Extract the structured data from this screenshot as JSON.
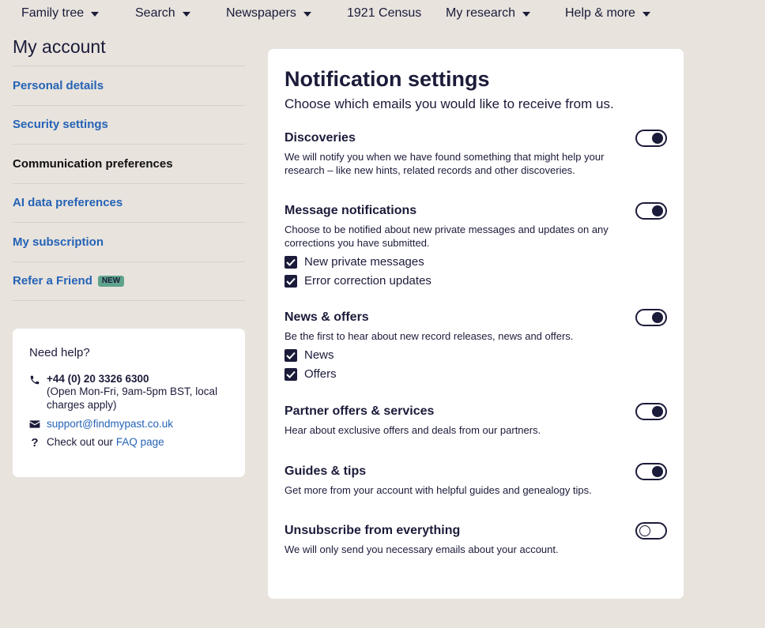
{
  "nav": {
    "items": [
      {
        "label": "Family tree",
        "dropdown": true
      },
      {
        "label": "Search",
        "dropdown": true
      },
      {
        "label": "Newspapers",
        "dropdown": true
      },
      {
        "label": "1921 Census",
        "dropdown": false
      },
      {
        "label": "My research",
        "dropdown": true
      },
      {
        "label": "Help & more",
        "dropdown": true
      }
    ]
  },
  "sidebar": {
    "title": "My account",
    "items": [
      {
        "label": "Personal details",
        "active": false
      },
      {
        "label": "Security settings",
        "active": false
      },
      {
        "label": "Communication preferences",
        "active": true
      },
      {
        "label": "AI data preferences",
        "active": false
      },
      {
        "label": "My subscription",
        "active": false
      },
      {
        "label": "Refer a Friend",
        "active": false,
        "badge": "NEW"
      }
    ]
  },
  "help": {
    "title": "Need help?",
    "phone": "+44 (0) 20 3326 6300",
    "phone_hours": "(Open Mon-Fri, 9am-5pm BST, local charges apply)",
    "email": "support@findmypast.co.uk",
    "faq_prefix": "Check out our",
    "faq_link": "FAQ page"
  },
  "main": {
    "title": "Notification settings",
    "subtitle": "Choose which emails you would like to receive from us.",
    "sections": [
      {
        "title": "Discoveries",
        "description": "We will notify you when we have found something that might help your research – like new hints, related records and other discoveries.",
        "enabled": true,
        "options": []
      },
      {
        "title": "Message notifications",
        "description": "Choose to be notified about new private messages and updates on any corrections you have submitted.",
        "enabled": true,
        "options": [
          {
            "label": "New private messages",
            "checked": true
          },
          {
            "label": "Error correction updates",
            "checked": true
          }
        ]
      },
      {
        "title": "News & offers",
        "description": "Be the first to hear about new record releases, news and offers.",
        "enabled": true,
        "options": [
          {
            "label": "News",
            "checked": true
          },
          {
            "label": "Offers",
            "checked": true
          }
        ]
      },
      {
        "title": "Partner offers & services",
        "description": "Hear about exclusive offers and deals from our partners.",
        "enabled": true,
        "options": []
      },
      {
        "title": "Guides & tips",
        "description": "Get more from your account with helpful guides and genealogy tips.",
        "enabled": true,
        "options": []
      },
      {
        "title": "Unsubscribe from everything",
        "description": "We will only send you necessary emails about your account.",
        "enabled": false,
        "options": []
      }
    ]
  },
  "colors": {
    "background": "#e8e3dd",
    "navy": "#1b1b3a",
    "link": "#2563b6",
    "badge": "#5fa38c"
  }
}
